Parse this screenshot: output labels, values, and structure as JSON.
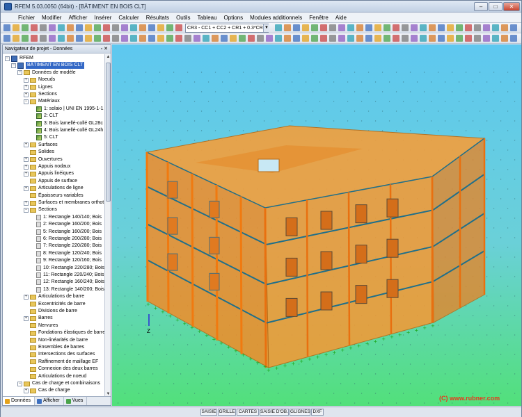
{
  "window": {
    "title": "RFEM 5.03.0050 (64bit) - [BÂTIMENT EN BOIS CLT]",
    "minimize": "–",
    "maximize": "□",
    "close": "✕"
  },
  "menu": [
    "Fichier",
    "Modifier",
    "Afficher",
    "Insérer",
    "Calculer",
    "Résultats",
    "Outils",
    "Tableau",
    "Options",
    "Modules additionnels",
    "Fenêtre",
    "Aide"
  ],
  "toolbar": {
    "load_combo": "CR3 - CC1 + CC2 + CR1 + 0.3*CR2"
  },
  "navigator": {
    "title": "Navigateur de projet - Données",
    "tree": [
      {
        "label": "RFEM",
        "level": 0,
        "icon": "app",
        "exp": "−"
      },
      {
        "label": "BÂTIMENT EN BOIS CLT",
        "level": 1,
        "icon": "root",
        "exp": "−",
        "selected": true
      },
      {
        "label": "Données de modèle",
        "level": 2,
        "icon": "folder",
        "exp": "−"
      },
      {
        "label": "Noeuds",
        "level": 3,
        "icon": "folder",
        "exp": "+"
      },
      {
        "label": "Lignes",
        "level": 3,
        "icon": "folder",
        "exp": "+"
      },
      {
        "label": "Sections",
        "level": 3,
        "icon": "folder",
        "exp": "+"
      },
      {
        "label": "Matériaux",
        "level": 3,
        "icon": "folder",
        "exp": "−"
      },
      {
        "label": "1: solaio | UNI EN 1995-1-1",
        "level": 4,
        "icon": "material"
      },
      {
        "label": "2: CLT",
        "level": 4,
        "icon": "material"
      },
      {
        "label": "3: Bois lamellé-collé GL28c",
        "level": 4,
        "icon": "material"
      },
      {
        "label": "4: Bois lamellé-collé GL24h",
        "level": 4,
        "icon": "material"
      },
      {
        "label": "5: CLT",
        "level": 4,
        "icon": "material"
      },
      {
        "label": "Surfaces",
        "level": 3,
        "icon": "folder",
        "exp": "+"
      },
      {
        "label": "Solides",
        "level": 3,
        "icon": "folder"
      },
      {
        "label": "Ouvertures",
        "level": 3,
        "icon": "folder",
        "exp": "+"
      },
      {
        "label": "Appuis nodaux",
        "level": 3,
        "icon": "folder",
        "exp": "+"
      },
      {
        "label": "Appuis linéiques",
        "level": 3,
        "icon": "folder",
        "exp": "+"
      },
      {
        "label": "Appuis de surface",
        "level": 3,
        "icon": "folder"
      },
      {
        "label": "Articulations de ligne",
        "level": 3,
        "icon": "folder",
        "exp": "+"
      },
      {
        "label": "Épaisseurs variables",
        "level": 3,
        "icon": "folder"
      },
      {
        "label": "Surfaces et membranes orthot",
        "level": 3,
        "icon": "folder",
        "exp": "+"
      },
      {
        "label": "Sections",
        "level": 3,
        "icon": "folder",
        "exp": "−"
      },
      {
        "label": "1: Rectangle 140/140; Bois",
        "level": 4,
        "icon": "section"
      },
      {
        "label": "2: Rectangle 160/200; Bois",
        "level": 4,
        "icon": "section"
      },
      {
        "label": "5: Rectangle 160/200; Bois",
        "level": 4,
        "icon": "section"
      },
      {
        "label": "6: Rectangle 200/280; Bois",
        "level": 4,
        "icon": "section"
      },
      {
        "label": "7: Rectangle 220/280; Bois",
        "level": 4,
        "icon": "section"
      },
      {
        "label": "8: Rectangle 120/240; Bois",
        "level": 4,
        "icon": "section"
      },
      {
        "label": "9: Rectangle 120/160; Bois",
        "level": 4,
        "icon": "section"
      },
      {
        "label": "10: Rectangle 220/280; Bois",
        "level": 4,
        "icon": "section"
      },
      {
        "label": "11: Rectangle 220/240; Bois",
        "level": 4,
        "icon": "section"
      },
      {
        "label": "12: Rectangle 160/240; Bois",
        "level": 4,
        "icon": "section"
      },
      {
        "label": "13: Rectangle 140/200; Bois",
        "level": 4,
        "icon": "section"
      },
      {
        "label": "Articulations de barre",
        "level": 3,
        "icon": "folder",
        "exp": "+"
      },
      {
        "label": "Excentricités de barre",
        "level": 3,
        "icon": "folder"
      },
      {
        "label": "Divisions de barre",
        "level": 3,
        "icon": "folder"
      },
      {
        "label": "Barres",
        "level": 3,
        "icon": "folder",
        "exp": "+"
      },
      {
        "label": "Nervures",
        "level": 3,
        "icon": "folder"
      },
      {
        "label": "Fondations élastiques de barre",
        "level": 3,
        "icon": "folder"
      },
      {
        "label": "Non-linéarités de barre",
        "level": 3,
        "icon": "folder"
      },
      {
        "label": "Ensembles de barres",
        "level": 3,
        "icon": "folder"
      },
      {
        "label": "Intersections des surfaces",
        "level": 3,
        "icon": "folder"
      },
      {
        "label": "Raffinement de maillage EF",
        "level": 3,
        "icon": "folder"
      },
      {
        "label": "Connexion des deux barres",
        "level": 3,
        "icon": "folder"
      },
      {
        "label": "Articulations de noeud",
        "level": 3,
        "icon": "folder"
      },
      {
        "label": "Cas de charge et combinaisons",
        "level": 2,
        "icon": "folder",
        "exp": "−"
      },
      {
        "label": "Cas de charge",
        "level": 3,
        "icon": "folder",
        "exp": "+"
      }
    ],
    "tabs": [
      "Données",
      "Afficher",
      "Vues"
    ]
  },
  "viewport": {
    "axis_label": "Z"
  },
  "statusbar": [
    "SAISIE",
    "GRILLE",
    "CARTES",
    "SAISIE D'OB.",
    "GLIGNES",
    "DXF"
  ],
  "watermark": "(C) www.rubner.com",
  "colors": {
    "viewport_top": "#5ec8f0",
    "viewport_bottom": "#52e07a",
    "timber": "#f28c28",
    "selection": "#3368c6"
  }
}
